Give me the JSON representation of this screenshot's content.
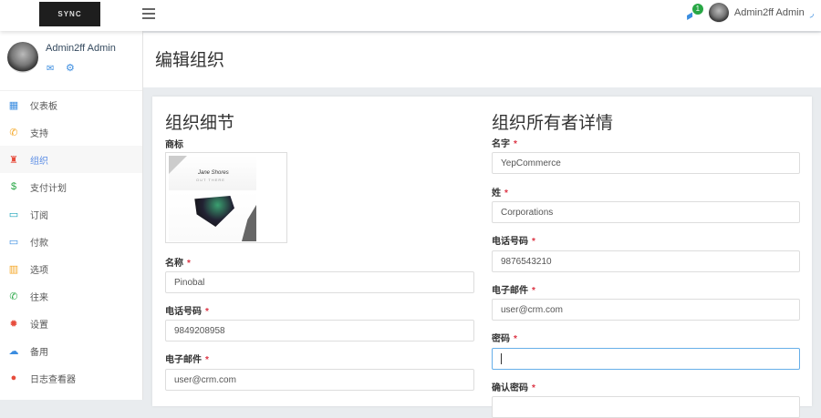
{
  "topbar": {
    "logo_text": "SYNC",
    "notification_count": "1",
    "user_name": "Admin2ff Admin"
  },
  "sidebar": {
    "profile_name": "Admin2ff Admin",
    "items": [
      {
        "label": "仪表板",
        "icon": "dashboard-icon",
        "color": "#3b8de0"
      },
      {
        "label": "支持",
        "icon": "phone-icon",
        "color": "#f5a623"
      },
      {
        "label": "组织",
        "icon": "chair-icon",
        "color": "#e74c3c",
        "active": true
      },
      {
        "label": "支付计划",
        "icon": "dollar-icon",
        "color": "#28a745"
      },
      {
        "label": "订阅",
        "icon": "card-icon",
        "color": "#17a2b8"
      },
      {
        "label": "付款",
        "icon": "card-icon",
        "color": "#3b8de0"
      },
      {
        "label": "选项",
        "icon": "grid-icon",
        "color": "#f5a623"
      },
      {
        "label": "往来",
        "icon": "phone-icon",
        "color": "#28a745"
      },
      {
        "label": "设置",
        "icon": "gear-icon",
        "color": "#e74c3c"
      },
      {
        "label": "备用",
        "icon": "cloud-upload-icon",
        "color": "#3b8de0"
      },
      {
        "label": "日志查看器",
        "icon": "alert-icon",
        "color": "#e74c3c"
      }
    ]
  },
  "page": {
    "title": "编辑组织"
  },
  "org": {
    "heading": "组织细节",
    "logo_label": "商标",
    "logo_image_text": "Jane Shores",
    "logo_image_subtext": "OUT THERE",
    "name_label": "名称",
    "name_value": "Pinobal",
    "phone_label": "电话号码",
    "phone_value": "9849208958",
    "email_label": "电子邮件",
    "email_value": "user@crm.com"
  },
  "owner": {
    "heading": "组织所有者详情",
    "first_label": "名字",
    "first_value": "YepCommerce",
    "last_label": "姓",
    "last_value": "Corporations",
    "phone_label": "电话号码",
    "phone_value": "9876543210",
    "email_label": "电子邮件",
    "email_value": "user@crm.com",
    "password_label": "密码",
    "password_value": "",
    "confirm_label": "确认密码"
  },
  "required_mark": "*"
}
